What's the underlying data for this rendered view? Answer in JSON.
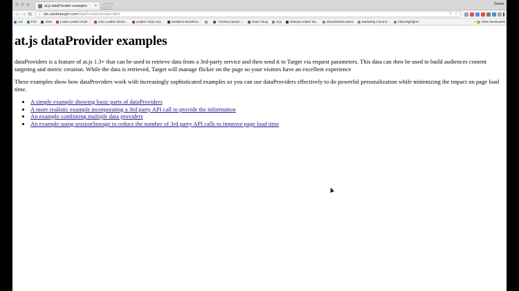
{
  "window": {
    "tab_title": "at.js dataProvider examples",
    "tab_close": "×",
    "user_name": "Daniel"
  },
  "toolbar": {
    "url_host": "lab.adobetarget.com",
    "url_path": "/dataProviders/index.html"
  },
  "bookmarks": {
    "items": [
      {
        "label": "Cal",
        "color": "#3b7bd6"
      },
      {
        "label": "PSA",
        "color": "#2f8f4f"
      },
      {
        "label": "AEM",
        "color": "#444444"
      },
      {
        "label": "Leash Leather Push...",
        "color": "#c0392b"
      },
      {
        "label": "Vinci Leather Reclin...",
        "color": "#c0392b"
      },
      {
        "label": "Leather Chair And...",
        "color": "#c0392b"
      },
      {
        "label": "Headless WordPres...",
        "color": "#333333"
      },
      {
        "label": "",
        "color": "#999999"
      },
      {
        "label": "* Delivery Board -...",
        "color": "#2c5aa0"
      },
      {
        "label": "React Shop",
        "color": "#2e7d32"
      },
      {
        "label": "at.js",
        "color": "#888888"
      },
      {
        "label": "Release Adobe Tar...",
        "color": "#333333"
      },
      {
        "label": "mboxDeleteCookies",
        "color": "#888888"
      },
      {
        "label": "Marketing Cloud D...",
        "color": "#888888"
      },
      {
        "label": "mboxHighlight+",
        "color": "#888888"
      }
    ],
    "more_label": "Other Bookmarks"
  },
  "page": {
    "heading": "at.js dataProvider examples",
    "intro": "dataProviders is a feature of at.js 1.3+ that can be used to retrieve data from a 3rd-party service and then send it to Target via request parameters. This data can then be used to build audiences content targeting and metric creation. While the data is retrieved, Target will manage flicker on the page so your visitors have an excellent experience",
    "description": "These examples show how dataProviders work with increasingly sophisticated examples so you can use dataProviders effectively to do powerful personalization while minimizing the impact on page load time.",
    "links": [
      "A simple example showing basic parts of dataProviders",
      "A more realistic example incorporating a 3rd party API call to provide the information",
      "An example combining multiple data providers",
      "An example using sessionStorage to reduce the number of 3rd party API calls to improve page load time"
    ]
  }
}
